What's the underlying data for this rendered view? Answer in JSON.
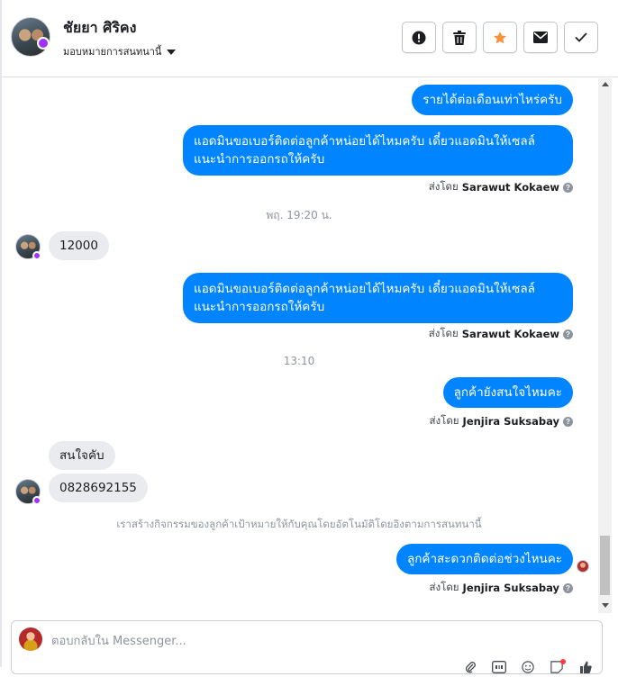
{
  "header": {
    "contact_name": "ชัยยา ศิริคง",
    "assign_label": "มอบหมายการสนทนานี้",
    "toolbar": [
      {
        "name": "mark-spam-button",
        "icon": "exclamation-circle-icon"
      },
      {
        "name": "delete-button",
        "icon": "trash-icon"
      },
      {
        "name": "star-button",
        "icon": "star-icon",
        "color": "#f7923a"
      },
      {
        "name": "mark-unread-button",
        "icon": "envelope-icon"
      },
      {
        "name": "mark-done-button",
        "icon": "checkmark-icon"
      }
    ]
  },
  "messages": {
    "m1": {
      "text": "รายได้ต่อเดือนเท่าไหร่ครับ"
    },
    "m2": {
      "line1": "แอดมินขอเบอร์ติดต่อลูกค้าหน่อยได้ไหมครับ เดี๋ยวแอดมินให้เซลล์",
      "line2": "แนะนำการออกรถให้ครับ",
      "sent_by_prefix": "ส่งโดย",
      "sent_by_name": "Sarawut Kokaew"
    },
    "ts1": "พฤ. 19:20 น.",
    "m3": {
      "text": "12000"
    },
    "m4": {
      "line1": "แอดมินขอเบอร์ติดต่อลูกค้าหน่อยได้ไหมครับ เดี๋ยวแอดมินให้เซลล์",
      "line2": "แนะนำการออกรถให้ครับ",
      "sent_by_prefix": "ส่งโดย",
      "sent_by_name": "Sarawut Kokaew"
    },
    "ts2": "13:10",
    "m5": {
      "text": "ลูกค้ายังสนใจไหมคะ",
      "sent_by_prefix": "ส่งโดย",
      "sent_by_name": "Jenjira Suksabay"
    },
    "m6": {
      "text": "สนใจคับ"
    },
    "m7": {
      "text": "0828692155"
    },
    "system_note": "เราสร้างกิจกรรมของลูกค้าเป้าหมายให้กับคุณโดยอัตโนมัติโดยอิงตามการสนทนานี้",
    "m8": {
      "text": "ลูกค้าสะดวกติดต่อช่วงไหนคะ",
      "sent_by_prefix": "ส่งโดย",
      "sent_by_name": "Jenjira Suksabay"
    },
    "help_glyph": "?"
  },
  "composer": {
    "placeholder": "ตอบกลับใน Messenger...",
    "tools": [
      "attachment-icon",
      "gif-icon",
      "emoji-icon",
      "sticker-icon",
      "thumbs-up-icon"
    ]
  },
  "colors": {
    "outgoing_bubble": "#0084ff",
    "incoming_bubble": "#e9ebee",
    "star_accent": "#f7923a",
    "avatar_badge": "#a033ff"
  }
}
